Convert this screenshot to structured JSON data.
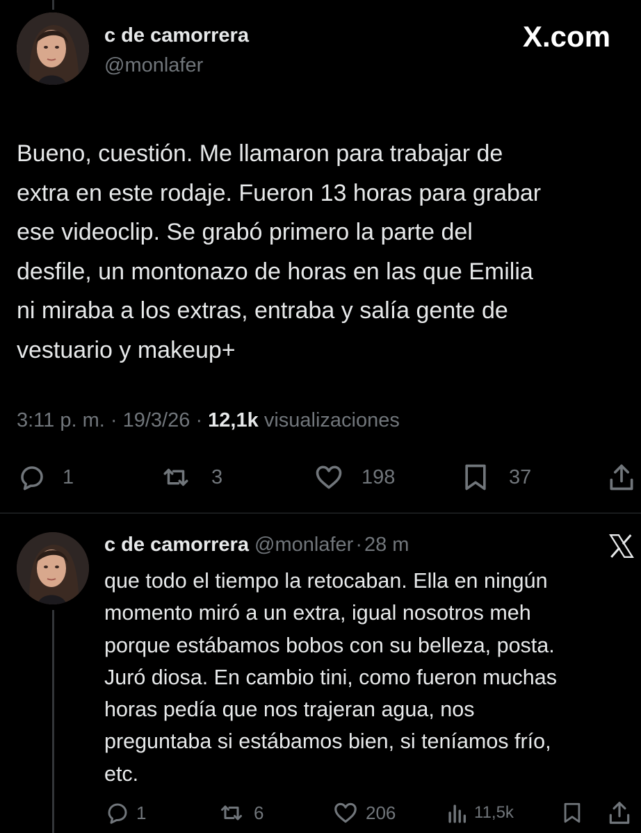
{
  "main_tweet": {
    "author_name": "c de camorrera",
    "handle": "@monlafer",
    "brand": "X.com",
    "text_lines": [
      "Bueno, cuestión. Me llamaron para trabajar de",
      "extra en este rodaje. Fueron 13 horas para grabar",
      "ese videoclip. Se grabó primero la parte del",
      "desfile, un montonazo de horas en las que Emilia",
      "ni miraba a los extras, entraba y salía gente de",
      "vestuario y makeup+"
    ],
    "time": "3:11 p. m.",
    "sep1": "·",
    "date": "19/3/26",
    "sep2": "·",
    "views_count": "12,1k",
    "views_label": "visualizaciones",
    "actions": {
      "replies": "1",
      "reposts": "3",
      "likes": "198",
      "bookmarks": "37"
    },
    "icons": [
      "reply-icon",
      "repost-icon",
      "like-icon",
      "bookmark-icon",
      "share-icon"
    ]
  },
  "reply_tweet": {
    "author_name": "c de camorrera",
    "handle": "@monlafer",
    "sep": "·",
    "age": "28 m",
    "text_lines": [
      "que todo el tiempo la retocaban. Ella en ningún",
      "momento miró a un extra, igual nosotros meh",
      "porque estábamos bobos con su belleza, posta.",
      "Juró diosa. En cambio tini, como fueron muchas",
      "horas pedía que nos trajeran agua, nos",
      "preguntaba si estábamos bien, si teníamos frío,",
      "etc."
    ],
    "actions": {
      "replies": "1",
      "reposts": "6",
      "likes": "206",
      "views": "11,5k"
    },
    "icons": [
      "reply-icon",
      "repost-icon",
      "like-icon",
      "views-icon",
      "bookmark-icon",
      "share-icon",
      "x-logo-icon"
    ]
  },
  "colors": {
    "background": "#000000",
    "text": "#e7e9ea",
    "muted": "#71767b",
    "divider": "#2f3336"
  }
}
